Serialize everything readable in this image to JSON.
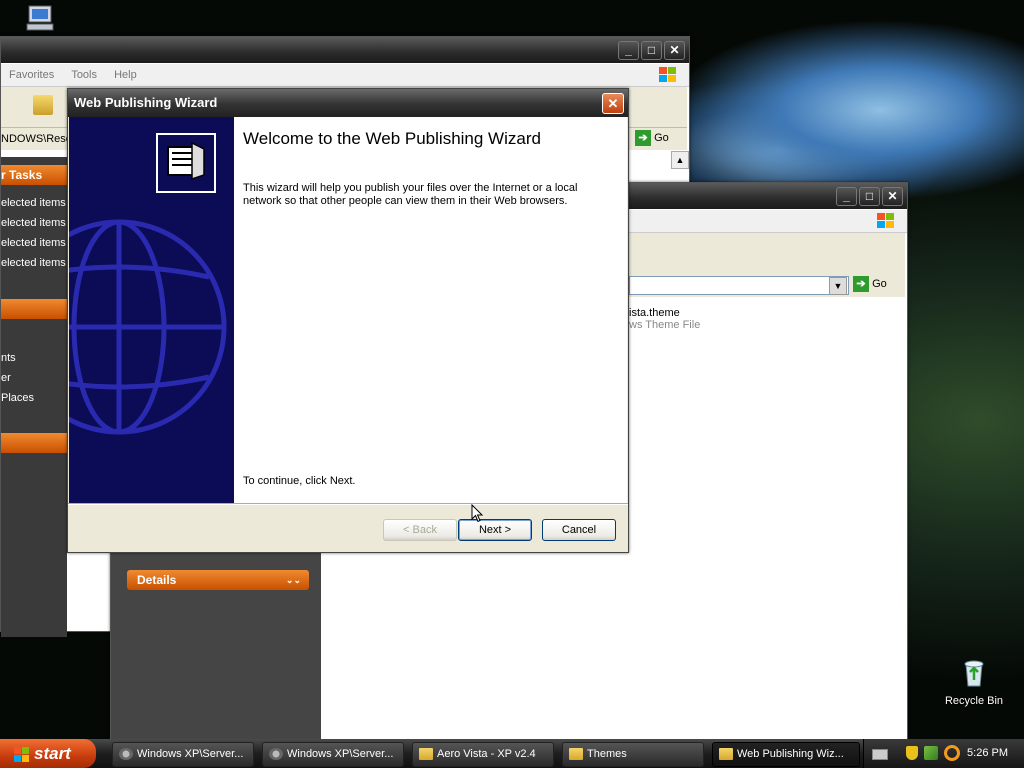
{
  "desktop": {
    "icons": [
      {
        "label": "Recycle Bin"
      }
    ]
  },
  "explorer_back": {
    "menu": [
      "Favorites",
      "Tools",
      "Help"
    ],
    "address_fragment": "NDOWS\\Resou",
    "go_label": "Go",
    "tasks_header": "r Tasks",
    "task_links": [
      "elected items",
      "elected items",
      "elected items",
      "elected items"
    ],
    "other_places": [
      "nts",
      "er",
      " Places"
    ]
  },
  "explorer_front": {
    "go_label": "Go",
    "file_name": "ista.theme",
    "file_type": "ws Theme File",
    "details_label": "Details"
  },
  "wizard": {
    "title": "Web Publishing Wizard",
    "heading": "Welcome to the Web Publishing Wizard",
    "body": "This wizard will help you publish your files over the Internet or a local network so that other people can view them in their Web browsers.",
    "continue_text": "To continue, click Next.",
    "buttons": {
      "back": "< Back",
      "next": "Next >",
      "cancel": "Cancel"
    }
  },
  "taskbar": {
    "start_label": "start",
    "items": [
      {
        "label": "Windows XP\\Server..."
      },
      {
        "label": "Windows XP\\Server..."
      },
      {
        "label": "Aero Vista - XP v2.4"
      },
      {
        "label": "Themes"
      },
      {
        "label": "Web Publishing Wiz..."
      }
    ],
    "clock": "5:26 PM"
  }
}
